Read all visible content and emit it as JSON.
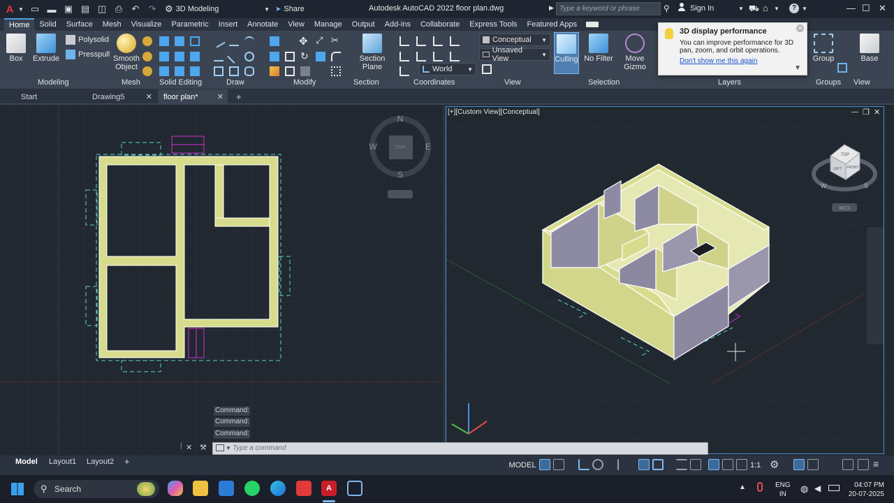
{
  "titlebar": {
    "workspace": "3D Modeling",
    "share": "Share",
    "title": "Autodesk AutoCAD 2022   floor plan.dwg",
    "search_placeholder": "Type a keyword or phrase",
    "sign_in": "Sign In"
  },
  "ribbon_tabs": [
    "Home",
    "Solid",
    "Surface",
    "Mesh",
    "Visualize",
    "Parametric",
    "Insert",
    "Annotate",
    "View",
    "Manage",
    "Output",
    "Add-ins",
    "Collaborate",
    "Express Tools",
    "Featured Apps"
  ],
  "ribbon": {
    "box": "Box",
    "extrude": "Extrude",
    "polysolid": "Polysolid",
    "presspull": "Presspull",
    "smooth_object_1": "Smooth",
    "smooth_object_2": "Object",
    "section_plane_1": "Section",
    "section_plane_2": "Plane",
    "visual_style": "Conceptual",
    "view_name": "Unsaved View",
    "ucs": "World",
    "culling": "Culling",
    "no_filter": "No Filter",
    "move_gizmo_1": "Move",
    "move_gizmo_2": "Gizmo",
    "group": "Group",
    "base": "Base",
    "panels": [
      "Modeling",
      "Mesh",
      "Solid Editing",
      "Draw",
      "Modify",
      "Section",
      "Coordinates",
      "View",
      "Selection",
      "Layers",
      "Groups",
      "View"
    ]
  },
  "tooltip": {
    "title": "3D display performance",
    "body": "You can improve performance for 3D pan, zoom, and orbit operations.",
    "link": "Don't show me this again"
  },
  "file_tabs": [
    "Start",
    "Drawing5",
    "floor plan*"
  ],
  "viewport_right_label": "[+][Custom View][Conceptual]",
  "compass": {
    "n": "N",
    "s": "S",
    "e": "E",
    "w": "W",
    "top": "TOP"
  },
  "viewcube": {
    "top": "TOP",
    "left": "LEFT",
    "front": "FRONT",
    "w": "W",
    "s": "S",
    "wcs": "WCS"
  },
  "command_history": [
    "Command:",
    "Command:",
    "Command:"
  ],
  "command_placeholder": "Type a command",
  "layout_tabs": [
    "Model",
    "Layout1",
    "Layout2"
  ],
  "status": {
    "model": "MODEL",
    "scale": "1:1"
  },
  "taskbar": {
    "search": "Search",
    "lang1": "ENG",
    "lang2": "IN",
    "time": "04:07 PM",
    "date": "20-07-2025"
  },
  "colors": {
    "wall": "#d7dc8c",
    "wall_edge": "#ffffff",
    "accent": "#4a9fe5"
  }
}
